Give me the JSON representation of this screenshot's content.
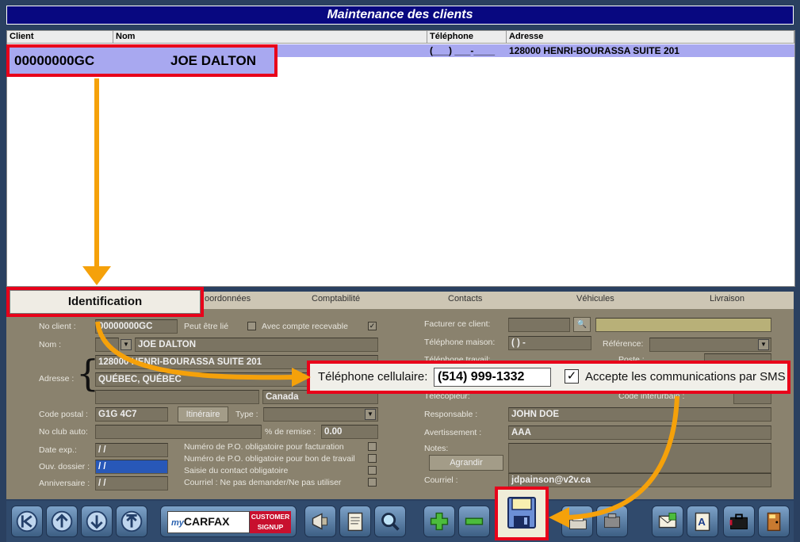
{
  "window": {
    "title": "Maintenance des clients"
  },
  "grid": {
    "headers": [
      "Client",
      "Nom",
      "Téléphone",
      "Adresse"
    ],
    "row": {
      "client": "00000000GC",
      "nom": "JOE DALTON",
      "telephone": "(___) ___-____",
      "adresse": "128000 HENRI-BOURASSA SUITE 201"
    }
  },
  "tabs": [
    "Identification",
    "Coordonnées",
    "Comptabilité",
    "Contacts",
    "Véhicules",
    "Livraison"
  ],
  "tabs_visible": [
    "oordonnées",
    "Comptabilité",
    "Contacts",
    "Véhicules",
    "Livraison"
  ],
  "left": {
    "no_client_label": "No client :",
    "no_client": "00000000GC",
    "peut_etre_lie": "Peut être lié",
    "avec_compte": "Avec compte recevable",
    "nom_label": "Nom :",
    "nom": "JOE DALTON",
    "adresse_label": "Adresse :",
    "adresse1": "128000 HENRI-BOURASSA SUITE 201",
    "adresse2": "QUÉBEC, QUÉBEC",
    "pays": "Canada",
    "code_postal_label": "Code postal :",
    "code_postal": "G1G 4C7",
    "itineraire": "Itinéraire",
    "type_label": "Type :",
    "no_club_label": "No club auto:",
    "pct_remise_label": "% de remise :",
    "pct_remise": "0.00",
    "date_exp_label": "Date exp.:",
    "date_exp": "/  /",
    "ouv_dossier_label": "Ouv. dossier :",
    "ouv_dossier": "/  /",
    "anniversaire_label": "Anniversaire :",
    "anniversaire": "/  /",
    "po_facturation": "Numéro de P.O. obligatoire pour facturation",
    "po_bon_travail": "Numéro de P.O. obligatoire pour bon de travail",
    "saisie_contact": "Saisie du contact obligatoire",
    "courriel_option": "Courriel : Ne pas demander/Ne pas utiliser"
  },
  "right": {
    "facturer_label": "Facturer ce client:",
    "tel_maison_label": "Téléphone maison:",
    "tel_maison": "(   )      -",
    "reference_label": "Référence:",
    "tel_travail_label": "Téléphone travail:",
    "poste_label": "Poste :",
    "telecopieur_label": "Télécopieur:",
    "code_interurbain_label": "Code interurbain :",
    "responsable_label": "Responsable :",
    "responsable": "JOHN DOE",
    "avertissement_label": "Avertissement :",
    "avertissement": "AAA",
    "notes_label": "Notes:",
    "agrandir": "Agrandir",
    "courriel_label": "Courriel :",
    "courriel": "jdpainson@v2v.ca"
  },
  "highlight": {
    "cell_label": "Téléphone cellulaire:",
    "cell_value": "(514) 999-1332",
    "sms_label": "Accepte les communications par SMS"
  },
  "toolbar": {
    "carfax_my": "my",
    "carfax_brand": "CARFAX",
    "carfax_signup1": "CUSTOMER",
    "carfax_signup2": "SIGNUP"
  },
  "colors": {
    "highlight": "#e8001a",
    "arrow": "#f5a10a",
    "title_bar": "#080880",
    "panel": "#8a826e"
  }
}
